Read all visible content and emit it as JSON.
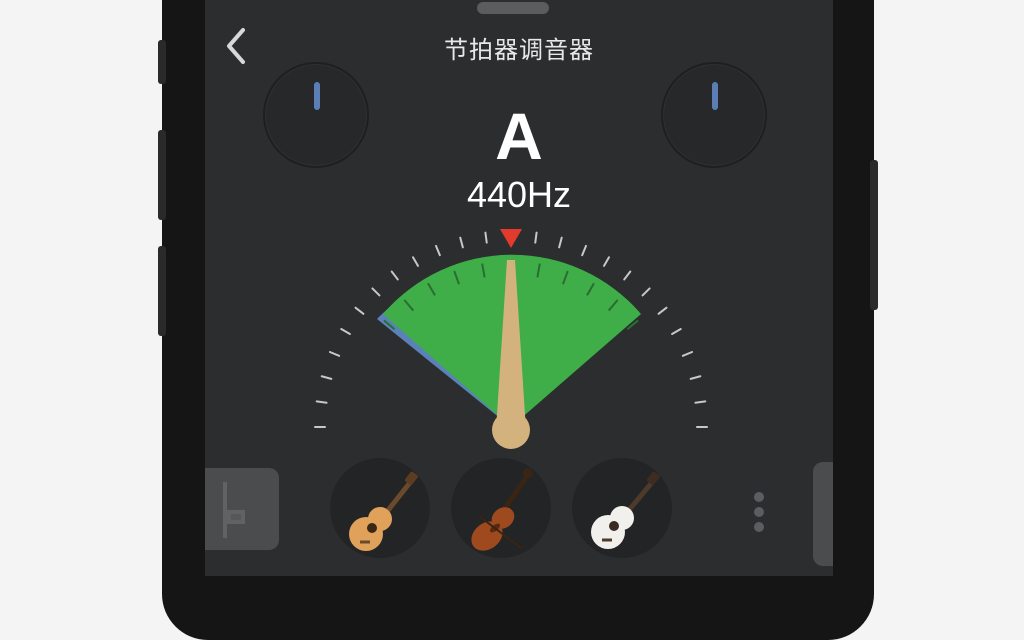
{
  "header": {
    "title": "节拍器调音器",
    "back_icon": "chevron-left-icon"
  },
  "tuner": {
    "note": "A",
    "frequency": "440Hz",
    "deviation_cents": 0,
    "in_tune": true
  },
  "knobs": [
    {
      "name": "left-knob",
      "icon": "knob-icon"
    },
    {
      "name": "right-knob",
      "icon": "knob-icon"
    }
  ],
  "instruments": [
    {
      "name": "acoustic-guitar",
      "icon": "acoustic-guitar-icon"
    },
    {
      "name": "violin",
      "icon": "violin-icon"
    },
    {
      "name": "classical-guitar",
      "icon": "classical-guitar-icon"
    }
  ],
  "colors": {
    "in_tune_zone": "#3fae49",
    "flat_zone": "#5b82b8",
    "needle": "#d3b27d",
    "marker": "#e23a2c",
    "background": "#2b2d2f"
  },
  "more_icon": "more-vertical-icon"
}
